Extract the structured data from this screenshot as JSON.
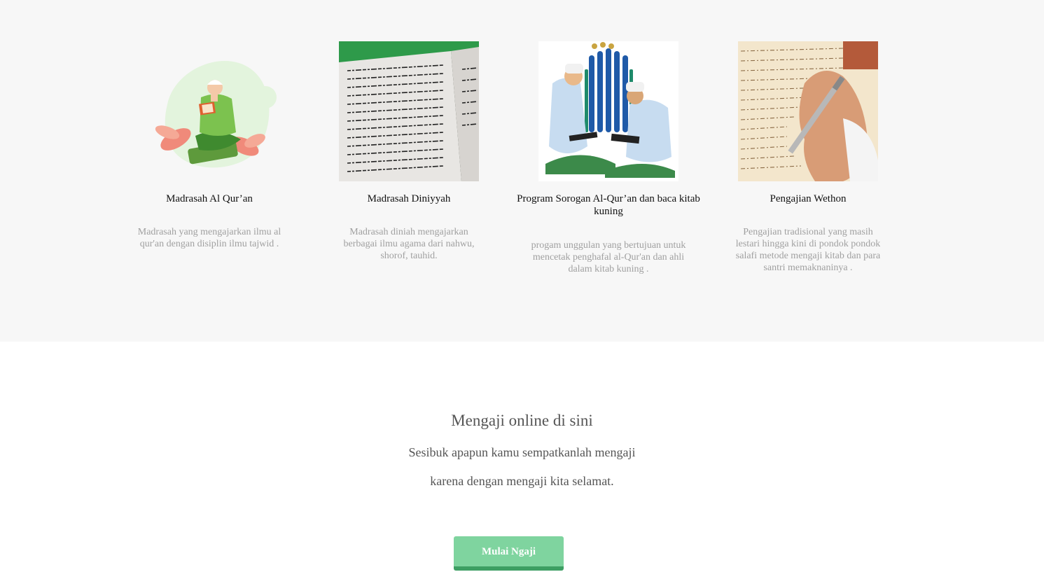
{
  "programs": [
    {
      "title": "Madrasah Al Qur’an",
      "description": "Madrasah yang mengajarkan ilmu al qur'an dengan disiplin ilmu tajwid .",
      "image": "reading-quran-illustration"
    },
    {
      "title": "Madrasah Diniyyah",
      "description": "Madrasah diniah mengajarkan berbagai ilmu agama dari nahwu, shorof, tauhid.",
      "image": "arabic-book-photo"
    },
    {
      "title": "Program Sorogan Al-Qur’an dan baca kitab kuning",
      "description": "progam unggulan yang bertujuan untuk mencetak penghafal al-Qur'an dan ahli dalam kitab kuning .",
      "image": "santri-studying-illustration"
    },
    {
      "title": "Pengajian Wethon",
      "description": "Pengajian tradisional yang masih lestari hingga kini di pondok pondok salafi metode mengaji kitab dan para santri memaknaninya .",
      "image": "writing-kitab-photo"
    }
  ],
  "cta": {
    "title": "Mengaji online di sini",
    "line1": "Sesibuk apapun kamu sempatkanlah mengaji",
    "line2": "karena dengan mengaji kita selamat.",
    "button_label": "Mulai Ngaji"
  },
  "colors": {
    "section_bg": "#f7f7f7",
    "button_bg": "#7fd49f",
    "button_border": "#3d9f63"
  }
}
